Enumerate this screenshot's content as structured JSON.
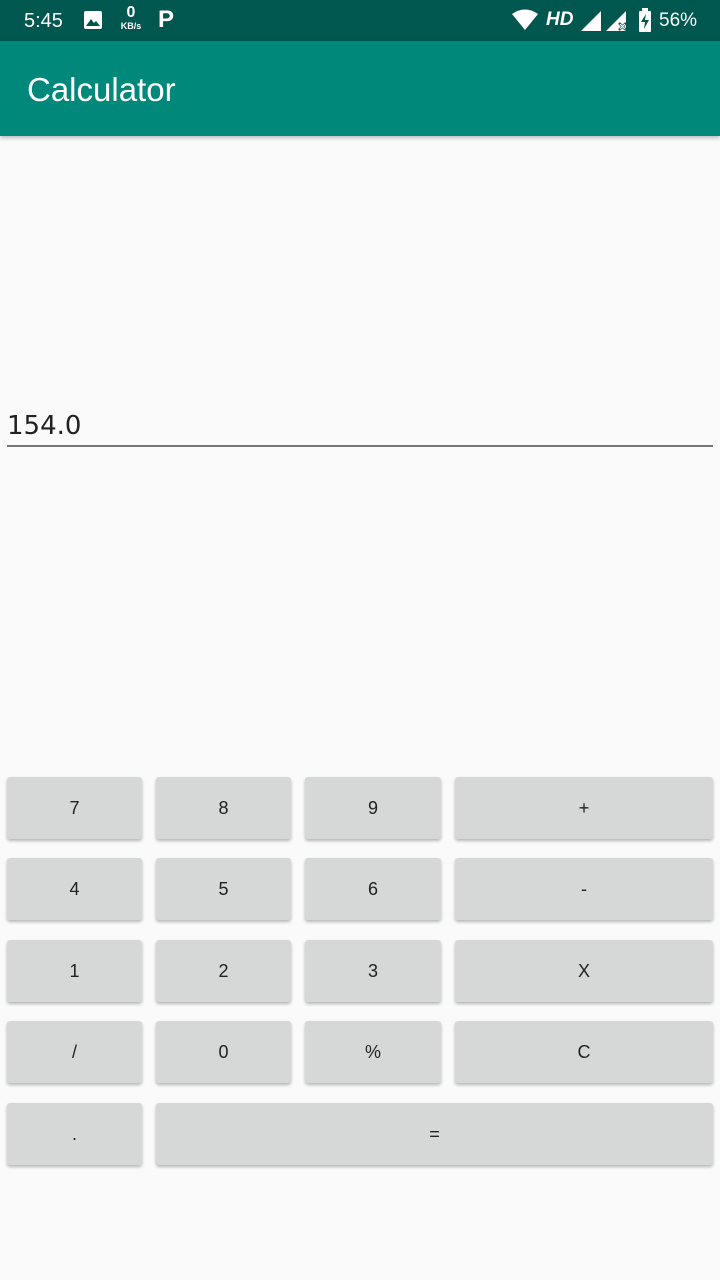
{
  "status_bar": {
    "time": "5:45",
    "net_speed_value": "0",
    "net_speed_unit": "KB/s",
    "app_indicator": "P",
    "network_type": "HD",
    "battery_percent": "56%",
    "icons": [
      "gallery-icon",
      "wifi-icon",
      "cell-signal-icon",
      "cell-signal-no-data-icon",
      "battery-charging-icon"
    ]
  },
  "app_bar": {
    "title": "Calculator",
    "color": "#00897b",
    "status_color": "#00574f"
  },
  "display": {
    "value": "154.0"
  },
  "keypad": {
    "row1": [
      "7",
      "8",
      "9",
      "+"
    ],
    "row2": [
      "4",
      "5",
      "6",
      "-"
    ],
    "row3": [
      "1",
      "2",
      "3",
      "X"
    ],
    "row4": [
      "/",
      "0",
      "%",
      "C"
    ],
    "row5": [
      ".",
      "="
    ]
  }
}
